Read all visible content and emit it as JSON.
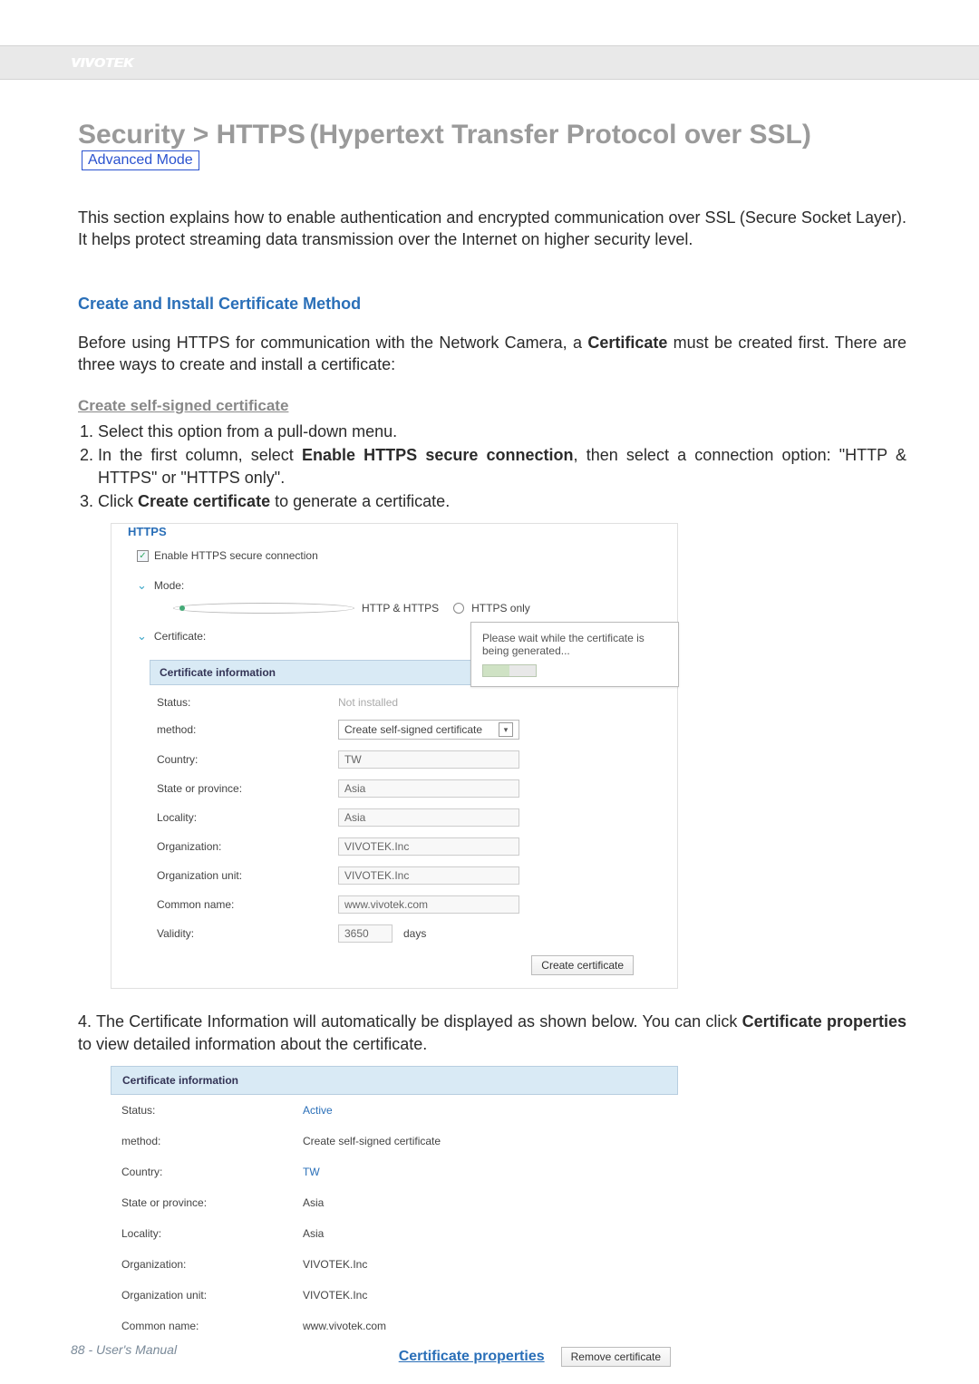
{
  "brand": "VIVOTEK",
  "title_main": "Security  >   HTTPS",
  "title_sub": "(Hypertext Transfer Protocol over SSL)",
  "adv_badge": "Advanced Mode",
  "intro": "This section explains how to enable authentication and encrypted communication over SSL (Secure Socket Layer). It helps protect streaming data transmission over the Internet on higher security level.",
  "h2": "Create and Install Certificate Method",
  "before_para_pre": "Before using HTTPS for communication with the Network Camera, a ",
  "before_para_bold": "Certificate",
  "before_para_post": " must be created first. There are three ways to create and install a certificate:",
  "subhead": "Create self-signed certificate",
  "steps": {
    "s1": "Select this option from a pull-down menu.",
    "s2_pre": "In the first column, select ",
    "s2_bold": "Enable HTTPS secure connection",
    "s2_post": ", then select a connection option: \"HTTP & HTTPS\" or \"HTTPS only\".",
    "s3_pre": "Click ",
    "s3_bold": "Create certificate",
    "s3_post": " to generate a certificate."
  },
  "shot1": {
    "legend": "HTTPS",
    "enable_label": "Enable HTTPS secure connection",
    "mode_label": "Mode:",
    "opt1": "HTTP & HTTPS",
    "opt2": "HTTPS only",
    "cert_label": "Certificate:",
    "popup": "Please wait while the certificate is being generated...",
    "cert_head": "Certificate information",
    "rows": {
      "status_l": "Status:",
      "status_v": "Not installed",
      "method_l": "method:",
      "method_v": "Create self-signed certificate",
      "country_l": "Country:",
      "country_v": "TW",
      "state_l": "State or province:",
      "state_v": "Asia",
      "locality_l": "Locality:",
      "locality_v": "Asia",
      "org_l": "Organization:",
      "org_v": "VIVOTEK.Inc",
      "orgunit_l": "Organization unit:",
      "orgunit_v": "VIVOTEK.Inc",
      "cn_l": "Common name:",
      "cn_v": "www.vivotek.com",
      "valid_l": "Validity:",
      "valid_v": "3650",
      "valid_unit": "days"
    },
    "create_btn": "Create certificate"
  },
  "step4_pre": "4. The Certificate Information will automatically be displayed as shown below. You can click ",
  "step4_bold": "Certificate properties",
  "step4_post": " to view detailed information about the certificate.",
  "shot2": {
    "cert_head": "Certificate information",
    "rows": {
      "status_l": "Status:",
      "status_v": "Active",
      "method_l": "method:",
      "method_v": "Create self-signed certificate",
      "country_l": "Country:",
      "country_v": "TW",
      "state_l": "State or province:",
      "state_v": "Asia",
      "locality_l": "Locality:",
      "locality_v": "Asia",
      "org_l": "Organization:",
      "org_v": "VIVOTEK.Inc",
      "orgunit_l": "Organization unit:",
      "orgunit_v": "VIVOTEK.Inc",
      "cn_l": "Common name:",
      "cn_v": "www.vivotek.com"
    },
    "cert_props": "Certificate properties",
    "remove_btn": "Remove certificate"
  },
  "footer": "88 - User's Manual"
}
